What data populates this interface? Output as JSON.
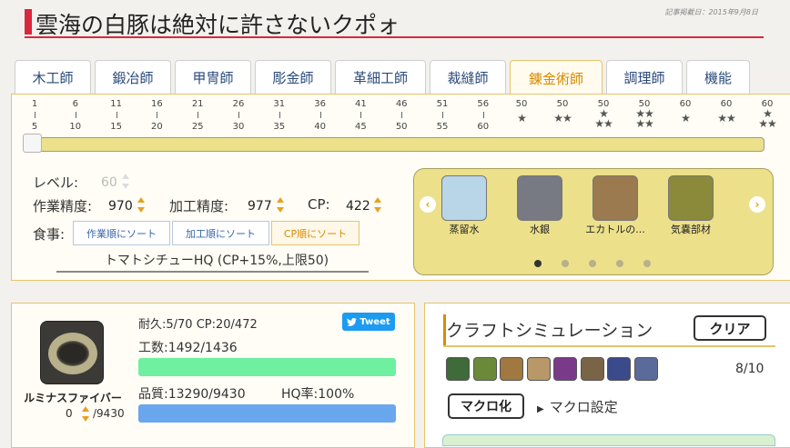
{
  "header": {
    "title": "雲海の白豚は絶対に許さないクポォ",
    "updated": "記事掲載日：2015年9月8日"
  },
  "tabs": [
    {
      "label": "木工師",
      "active": false
    },
    {
      "label": "鍛冶師",
      "active": false
    },
    {
      "label": "甲冑師",
      "active": false
    },
    {
      "label": "彫金師",
      "active": false
    },
    {
      "label": "革細工師",
      "active": false
    },
    {
      "label": "裁縫師",
      "active": false
    },
    {
      "label": "錬金術師",
      "active": true
    },
    {
      "label": "調理師",
      "active": false
    },
    {
      "label": "機能",
      "active": false
    }
  ],
  "level_scale": {
    "ticks": [
      {
        "top": "1",
        "bottom": "5"
      },
      {
        "top": "6",
        "bottom": "10"
      },
      {
        "top": "11",
        "bottom": "15"
      },
      {
        "top": "16",
        "bottom": "20"
      },
      {
        "top": "21",
        "bottom": "25"
      },
      {
        "top": "26",
        "bottom": "30"
      },
      {
        "top": "31",
        "bottom": "35"
      },
      {
        "top": "36",
        "bottom": "40"
      },
      {
        "top": "41",
        "bottom": "45"
      },
      {
        "top": "46",
        "bottom": "50"
      },
      {
        "top": "51",
        "bottom": "55"
      },
      {
        "top": "56",
        "bottom": "60"
      }
    ],
    "star_ticks": [
      {
        "level": "50",
        "stars": 1
      },
      {
        "level": "50",
        "stars": 2
      },
      {
        "level": "50",
        "stars": 3
      },
      {
        "level": "50",
        "stars": 4
      },
      {
        "level": "60",
        "stars": 1
      },
      {
        "level": "60",
        "stars": 2
      },
      {
        "level": "60",
        "stars": 3
      }
    ],
    "star_glyph": "★",
    "slider_fraction": 0
  },
  "stats": {
    "level_label": "レベル:",
    "level_value": "60",
    "craftsmanship_label": "作業精度:",
    "craftsmanship_value": "970",
    "control_label": "加工精度:",
    "control_value": "977",
    "cp_label": "CP:",
    "cp_value": "422"
  },
  "food": {
    "label": "食事:",
    "sort_buttons": [
      {
        "label": "作業順にソート",
        "active": false
      },
      {
        "label": "加工順にソート",
        "active": false
      },
      {
        "label": "CP順にソート",
        "active": true
      }
    ],
    "selected": "トマトシチューHQ (CP+15%,上限50)"
  },
  "carousel": {
    "prev": "‹",
    "next": "›",
    "items": [
      {
        "name": "蒸留水",
        "icon": "water-bottle-icon",
        "color": "#b9d6e8"
      },
      {
        "name": "水銀",
        "icon": "vial-icon",
        "color": "#777a82"
      },
      {
        "name": "エカトルの...",
        "icon": "crate-icon",
        "color": "#9a7a4e"
      },
      {
        "name": "気嚢部材",
        "icon": "bundle-icon",
        "color": "#8a8a3a"
      }
    ],
    "dots": 5,
    "active_dot": 0
  },
  "item": {
    "name": "ルミナスファイバー",
    "qty": "0",
    "qty_total": "/9430",
    "durability": "耐久:5/70 CP:20/472",
    "tweet_label": "Tweet",
    "progress_text": "工数:1492/1436",
    "progress_fraction": 1.0,
    "progress_color": "#6ef0a0",
    "quality_text": "品質:13290/9430",
    "hq_text": "HQ率:100%",
    "quality_fraction": 1.0,
    "quality_color": "#6aa6ee"
  },
  "simulation": {
    "title": "クラフトシミュレーション",
    "clear_label": "クリア",
    "count": "8/10",
    "actions": [
      {
        "icon": "inner-quiet-icon",
        "color": "#3f6a3a"
      },
      {
        "icon": "steady-hand-ii-icon",
        "color": "#6a8a3a"
      },
      {
        "icon": "hasty-touch-icon",
        "color": "#a07840"
      },
      {
        "icon": "ingenuity-icon",
        "color": "#b89868"
      },
      {
        "icon": "great-strides-icon",
        "color": "#7a3a8a"
      },
      {
        "icon": "manipulation-icon",
        "color": "#7a6448"
      },
      {
        "icon": "byregots-blessing-icon",
        "color": "#3a4a8a"
      },
      {
        "icon": "careful-synthesis-icon",
        "color": "#5a6a9a"
      }
    ],
    "macro_button": "マクロ化",
    "macro_link": "マクロ設定"
  }
}
